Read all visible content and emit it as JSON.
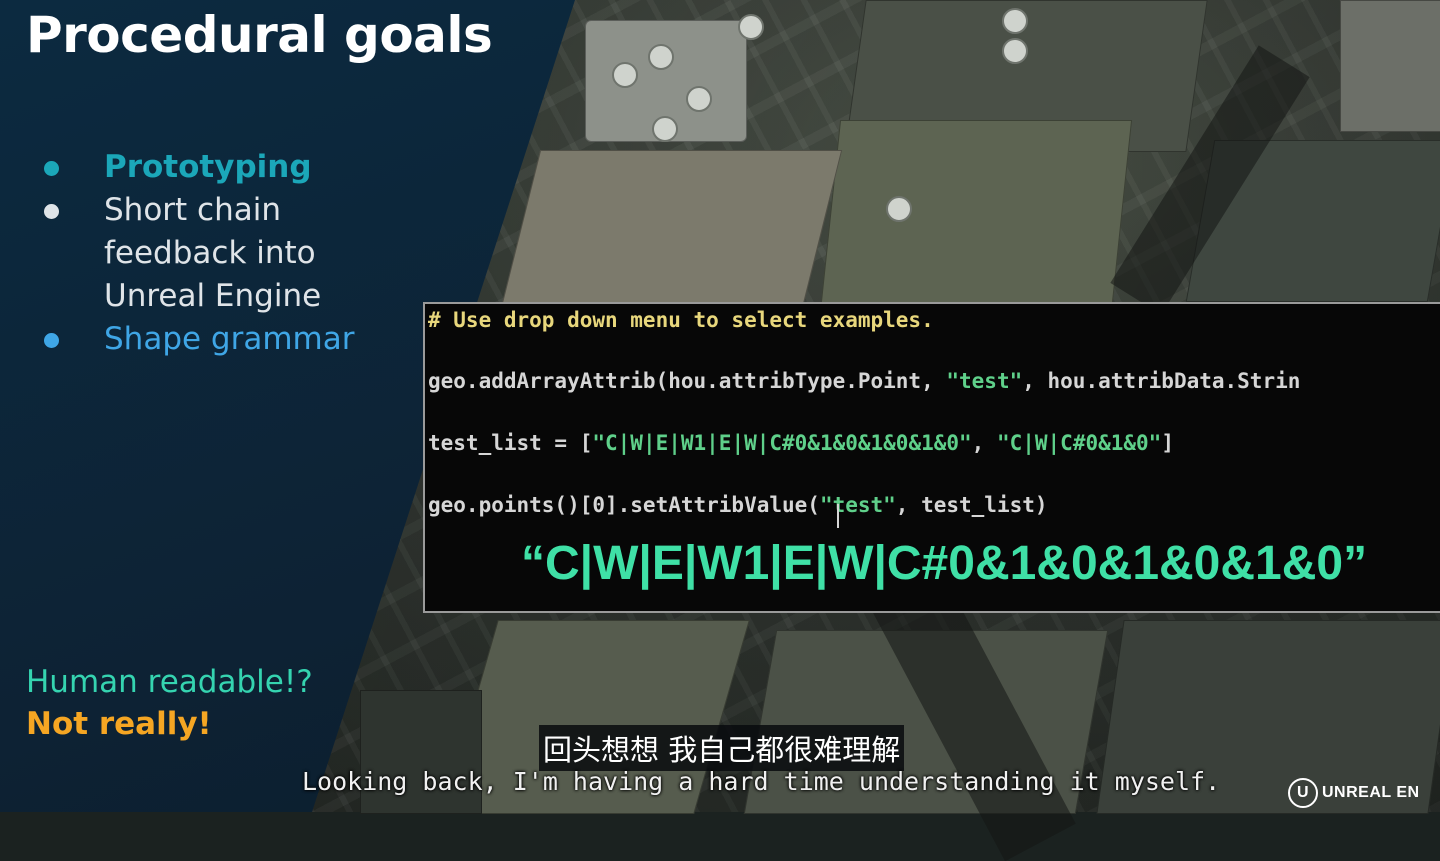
{
  "slide": {
    "title": "Procedural goals",
    "bullets": [
      {
        "text": "Prototyping",
        "color": "#1ba7b9"
      },
      {
        "text": "Short chain feedback into Unreal Engine",
        "color": "#dfe4e8"
      },
      {
        "text": "Shape grammar",
        "color": "#3fa6e6"
      }
    ],
    "note_line1": "Human readable!?",
    "note_line2": "Not really!"
  },
  "code_window": {
    "comment": "# Use drop down menu to select examples.",
    "line2_a": "geo.addArrayAttrib(hou.attribType.Point, ",
    "line2_str": "\"test\"",
    "line2_b": ", hou.attribData.Strin",
    "line3_a": "test_list = [",
    "line3_str1": "\"C|W|E|W1|E|W|C#0&1&0&1&0&1&0\"",
    "line3_sep": ", ",
    "line3_str2": "\"C|W|C#0&1&0\"",
    "line3_b": "]",
    "line4_a": "geo.points()[0].setAttribValue(",
    "line4_str": "\"test\"",
    "line4_b": ", test_list)",
    "highlight_string": "“C|W|E|W1|E|W|C#0&1&0&1&0&1&0”"
  },
  "subtitles": {
    "chinese": "回头想想 我自己都很难理解",
    "english": "Looking back, I'm having a hard time understanding it myself."
  },
  "watermark": {
    "logo_icon": "unreal-logo-icon",
    "text": "UNREAL EN"
  },
  "colors": {
    "panel": "#0d2234",
    "code_bg": "#070707",
    "code_string": "#5fd08a",
    "code_comment": "#e8d77c",
    "highlight": "#3fe0a6",
    "accent_orange": "#f5a623"
  }
}
